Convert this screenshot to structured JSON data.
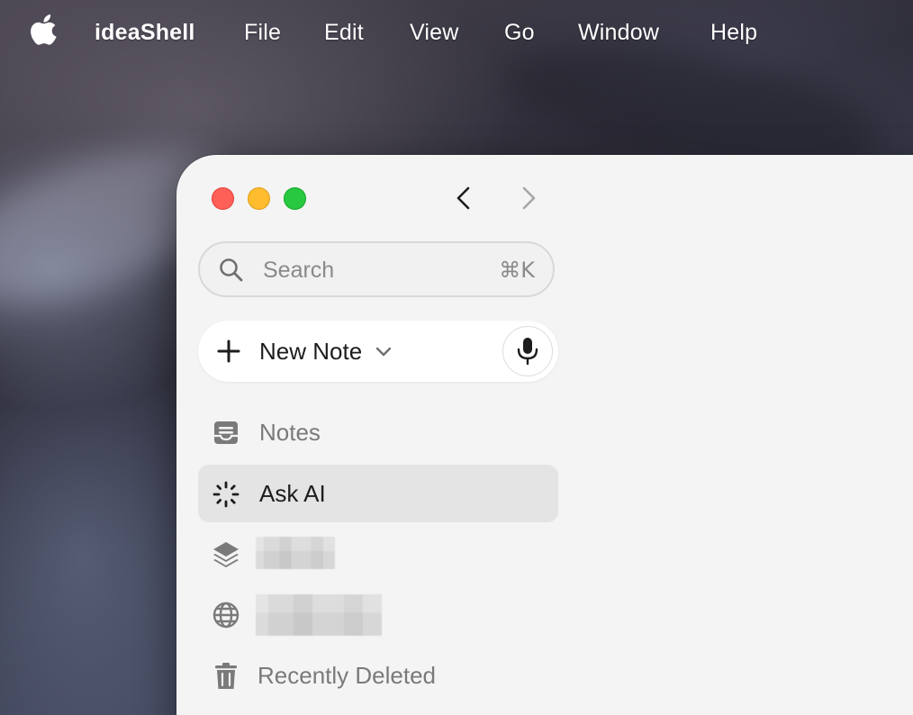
{
  "menubar": {
    "apple_icon": "apple-logo-icon",
    "app_name": "ideaShell",
    "items": [
      "File",
      "Edit",
      "View",
      "Go",
      "Window",
      "Help"
    ]
  },
  "window": {
    "traffic_lights": {
      "close_color": "#fe5f57",
      "minimize_color": "#febc2e",
      "zoom_color": "#28c840"
    },
    "nav": {
      "back_icon": "chevron-left-icon",
      "forward_icon": "chevron-right-icon",
      "forward_enabled": false
    },
    "search": {
      "placeholder": "Search",
      "shortcut": "⌘K",
      "icon": "search-icon"
    },
    "new_note": {
      "label": "New Note",
      "plus_icon": "plus-icon",
      "dropdown_icon": "chevron-down-icon",
      "mic_icon": "microphone-icon"
    },
    "sidebar": {
      "items": [
        {
          "label": "Notes",
          "icon": "notes-tray-icon",
          "active": false
        },
        {
          "label": "Ask AI",
          "icon": "ai-sparkle-icon",
          "active": true
        },
        {
          "label": "",
          "icon": "layers-icon",
          "active": false,
          "redacted": true
        },
        {
          "label": "",
          "icon": "globe-icon",
          "active": false,
          "redacted": true
        },
        {
          "label": "Recently Deleted",
          "icon": "trash-icon",
          "active": false
        }
      ]
    }
  }
}
